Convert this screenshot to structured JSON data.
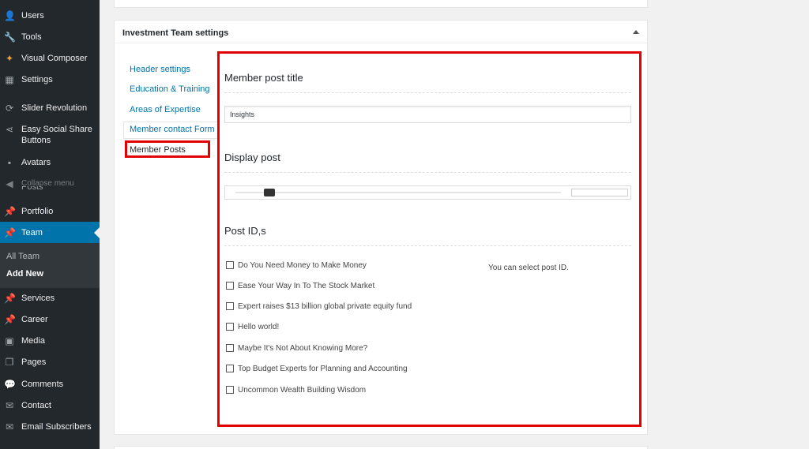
{
  "sidebar": {
    "items": [
      {
        "id": "users",
        "label": "Users",
        "icon": "users-icon",
        "glyph": "👤"
      },
      {
        "id": "tools",
        "label": "Tools",
        "icon": "wrench-icon",
        "glyph": "🔧"
      },
      {
        "id": "visual-composer",
        "label": "Visual Composer",
        "icon": "visual-composer-icon",
        "glyph": "✦"
      },
      {
        "id": "settings",
        "label": "Settings",
        "icon": "settings-icon",
        "glyph": "▦"
      },
      {
        "id": "slider-revolution",
        "label": "Slider Revolution",
        "icon": "refresh-icon",
        "glyph": "⟳"
      },
      {
        "id": "easy-social-share",
        "label": "Easy Social Share Buttons",
        "icon": "share-icon",
        "glyph": "⋖"
      },
      {
        "id": "avatars",
        "label": "Avatars",
        "icon": "avatar-icon",
        "glyph": "▪"
      },
      {
        "id": "collapse",
        "label": "Collapse menu",
        "icon": "collapse-icon",
        "glyph": "◀"
      },
      {
        "id": "posts",
        "label": "Posts",
        "icon": "pin-icon",
        "glyph": "📌"
      },
      {
        "id": "portfolio",
        "label": "Portfolio",
        "icon": "pin-icon",
        "glyph": "📌"
      },
      {
        "id": "team",
        "label": "Team",
        "icon": "pin-icon",
        "glyph": "📌"
      },
      {
        "id": "services",
        "label": "Services",
        "icon": "pin-icon",
        "glyph": "📌"
      },
      {
        "id": "career",
        "label": "Career",
        "icon": "pin-icon",
        "glyph": "📌"
      },
      {
        "id": "media",
        "label": "Media",
        "icon": "media-icon",
        "glyph": "▣"
      },
      {
        "id": "pages",
        "label": "Pages",
        "icon": "pages-icon",
        "glyph": "❐"
      },
      {
        "id": "comments",
        "label": "Comments",
        "icon": "comment-icon",
        "glyph": "💬"
      },
      {
        "id": "contact",
        "label": "Contact",
        "icon": "mail-icon",
        "glyph": "✉"
      },
      {
        "id": "email-subscribers",
        "label": "Email Subscribers",
        "icon": "mail-icon",
        "glyph": "✉"
      }
    ],
    "submenu": {
      "all_team": "All Team",
      "add_new": "Add New"
    }
  },
  "postbox": {
    "title": "Investment Team settings",
    "tabs": [
      "Header settings",
      "Education & Training",
      "Areas of Expertise",
      "Member contact Form",
      "Member Posts"
    ],
    "selected_tab": "Member Posts"
  },
  "member_post_title": {
    "heading": "Member post title",
    "value": "Insights"
  },
  "display_post": {
    "heading": "Display post",
    "value": ""
  },
  "post_ids": {
    "heading": "Post ID,s",
    "help": "You can select post ID.",
    "posts": [
      "Do You Need Money to Make Money",
      "Ease Your Way In To The Stock Market",
      "Expert raises $13 billion global private equity fund",
      "Hello world!",
      "Maybe It's Not About Knowing More?",
      "Top Budget Experts for Planning and Accounting",
      "Uncommon Wealth Building Wisdom"
    ]
  },
  "colors": {
    "sidebar_bg": "#23282d",
    "active_menu": "#0073aa",
    "highlight": "#e20000",
    "link": "#0073aa"
  }
}
